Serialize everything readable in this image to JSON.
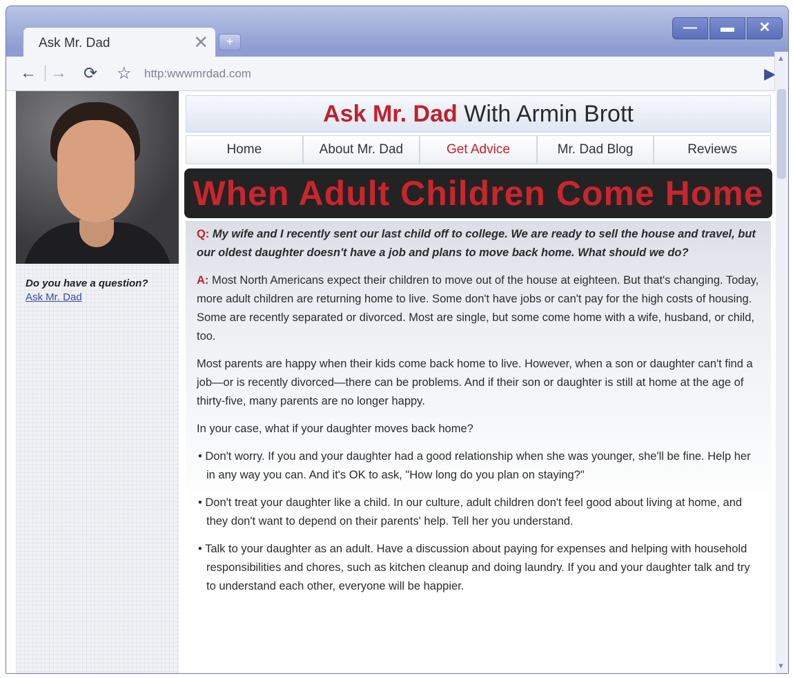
{
  "browser": {
    "tab_title": "Ask Mr. Dad",
    "tab_close": "✕",
    "new_tab": "+",
    "url": "http:wwwmrdad.com",
    "controls": {
      "minimize": "—",
      "maximize": "▬",
      "close": "✕"
    },
    "nav": {
      "back": "←",
      "forward": "→",
      "reload": "⟳",
      "bookmark": "☆",
      "go": "▶"
    }
  },
  "sidebar": {
    "question": "Do you have a question?",
    "link": "Ask Mr. Dad"
  },
  "site": {
    "brand": "Ask Mr. Dad",
    "brand_suffix": " With Armin Brott",
    "nav": [
      "Home",
      "About Mr. Dad",
      "Get Advice",
      "Mr. Dad Blog",
      "Reviews"
    ],
    "active_nav": "Get Advice",
    "headline": "When Adult Children Come Home"
  },
  "article": {
    "q_label": "Q:",
    "question": " My wife and I recently sent our last child off to college. We are ready to sell the house and travel, but our oldest daughter doesn't have a job and plans to move back home. What should we do?",
    "a_label": "A:",
    "answer": " Most North Americans expect their children to move out of the house at eighteen. But that's changing. Today, more adult children are returning home to live. Some don't have jobs or can't pay for the high costs of housing. Some are recently separated or divorced. Most are single, but some come home with a wife, husband, or child, too.",
    "para2": "Most parents are happy when their kids come back home to live. However, when a son or daughter can't find a job—or is recently divorced—there can be problems. And if their son or daughter is still at home at the age of thirty-five, many parents are no longer happy.",
    "para3": "In your case, what if your daughter moves back home?",
    "bullets": [
      "• Don't worry. If you and your daughter had a good relationship when she was younger, she'll be fine. Help her in any way you can. And it's OK to ask, \"How long do you plan on staying?\"",
      "• Don't treat your daughter like a child. In our culture, adult children don't feel good about living at home, and they don't want to depend on their parents' help. Tell her you understand.",
      "• Talk to your daughter as an adult. Have a discussion about paying for expenses and helping with household responsibilities and chores, such as kitchen cleanup and doing laundry. If you and your daughter talk and try to understand each other, everyone will be happier."
    ]
  },
  "colors": {
    "accent_red": "#c2202b",
    "link_blue": "#3a4c9c",
    "chrome_blue": "#8f9ed2"
  }
}
